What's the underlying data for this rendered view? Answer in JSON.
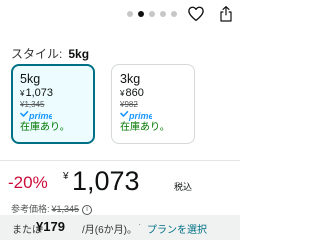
{
  "carousel": {
    "dot_count": 5,
    "active_index": 1
  },
  "style": {
    "label": "スタイル:",
    "value": "5kg"
  },
  "options": [
    {
      "title": "5kg",
      "price": "1,073",
      "yen": "¥",
      "list_price": "¥1,345",
      "prime": "prime",
      "stock": "在庫あり。",
      "selected": true
    },
    {
      "title": "3kg",
      "price": "860",
      "yen": "¥",
      "list_price": "¥982",
      "prime": "prime",
      "stock": "在庫あり。",
      "selected": false
    }
  ],
  "price": {
    "discount": "-20%",
    "yen": "¥",
    "value": "1,073",
    "tax": "税込"
  },
  "reference": {
    "label": "参考価格:",
    "value": "¥1,345"
  },
  "installment": {
    "prefix": "または",
    "amount": "¥179",
    "period": "/月(6か月)。",
    "separator": "·",
    "link": "プランを選択"
  },
  "colors": {
    "accent": "#007185",
    "discount": "#cc0c39",
    "stock": "#007600",
    "prime": "#1a98ff"
  }
}
